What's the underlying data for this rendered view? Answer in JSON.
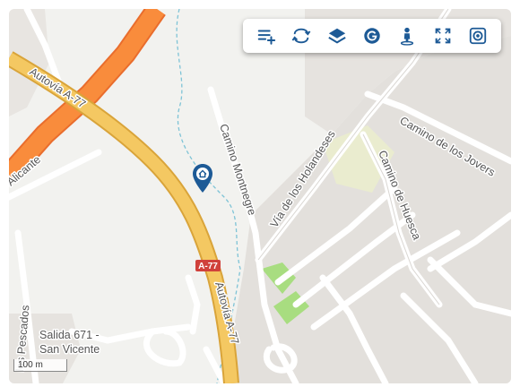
{
  "map": {
    "labels": {
      "autovia_a77_top": "Autovía A-77",
      "alicante": "Alicante",
      "camino_montnegre": "Camino Montnegre",
      "via_holandeses": "Vía de los Holandeses",
      "camino_jovers": "Camino de los Jovers",
      "camino_huesca": "Camino de Huesca",
      "autovia_a77_bottom": "Autovía A-77",
      "los_pescados": "los Pescados",
      "salida_line1": "Salida 671 -",
      "salida_line2": "San Vicente"
    },
    "road_shield": "A-77",
    "scale": "100 m",
    "poi_icon": "home-marker-icon"
  },
  "toolbar": {
    "buttons": [
      {
        "icon": "add-list-icon"
      },
      {
        "icon": "rotate-360-icon"
      },
      {
        "icon": "layers-icon"
      },
      {
        "icon": "google-g-icon"
      },
      {
        "icon": "street-view-person-icon"
      },
      {
        "icon": "fullscreen-icon"
      },
      {
        "icon": "target-icon"
      }
    ]
  },
  "colors": {
    "accent": "#1d5a96",
    "motorway": "#f4c862",
    "trunk": "#f98c3c",
    "green": "#a8dd80"
  }
}
